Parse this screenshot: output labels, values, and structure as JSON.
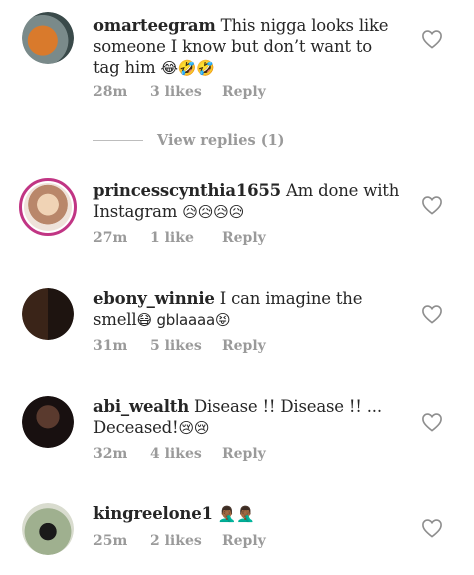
{
  "comments": [
    {
      "username": "omarteegram",
      "text": "This nigga looks like someone I know but don’t want to tag him",
      "emoji": "😂🤣🤣",
      "time": "28m",
      "likes": "3 likes",
      "reply": "Reply",
      "avatar_color": "#c86a2a"
    },
    {
      "username": "princesscynthia1655",
      "text": "Am done with Instagram",
      "emoji": "😥😥😥😥",
      "time": "27m",
      "likes": "1 like",
      "reply": "Reply",
      "avatar_color": "#e8c9a8"
    },
    {
      "username": "ebony_winnie",
      "text": "I can imagine the smell",
      "emoji": "😷 gblaaaa😝",
      "time": "31m",
      "likes": "5 likes",
      "reply": "Reply",
      "avatar_color": "#4a2c22"
    },
    {
      "username": "abi_wealth",
      "text": "Disease !! Disease !! ... Deceased!",
      "emoji": "😢😢",
      "time": "32m",
      "likes": "4 likes",
      "reply": "Reply",
      "avatar_color": "#2a2020"
    },
    {
      "username": "kingreelone1",
      "text": "",
      "emoji": "🤦🏾‍♂️🤦🏾‍♂️",
      "time": "25m",
      "likes": "2 likes",
      "reply": "Reply",
      "avatar_color": "#8a9a7a"
    }
  ],
  "view_replies": "View replies (1)",
  "colors": {
    "meta_gray": "#9a9a9a",
    "text": "#262626",
    "story_ring": "#c13584"
  },
  "icons": {
    "like": "heart-outline-icon"
  }
}
